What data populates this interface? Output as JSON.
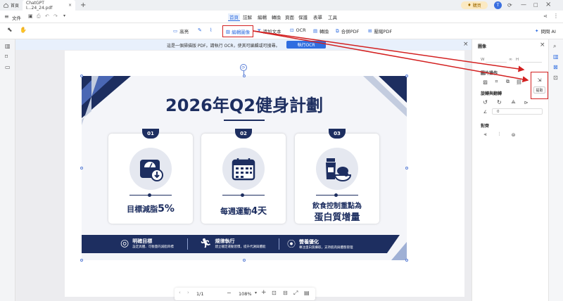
{
  "tabs": [
    {
      "label": "首頁"
    },
    {
      "label": "ChatGPT I...24_24.pdf"
    }
  ],
  "upgrade_label": "購買",
  "avatar_letter": "T",
  "file_menu": "文件",
  "menu_tabs": [
    "首頁",
    "註解",
    "編輯",
    "轉換",
    "頁面",
    "保護",
    "表單",
    "工具"
  ],
  "toolbar": {
    "highlight": "高亮",
    "edit_image": "編輯圖像",
    "add_text": "添加文本",
    "ocr": "OCR",
    "convert": "轉換",
    "merge": "合併PDF",
    "compress": "壓縮PDF",
    "ask_ai": "問問 AI"
  },
  "notice": {
    "text": "這是一個掃描版 PDF。請執行 OCR，使其可編輯或可搜尋。",
    "button": "執行OCR"
  },
  "slide": {
    "title": "2026年Q2健身計劃",
    "cards": [
      {
        "num": "01",
        "text": "目標減脂",
        "highlight": "5%"
      },
      {
        "num": "02",
        "text": "每週運動",
        "highlight": "4天"
      },
      {
        "num": "03",
        "text": "飲食控制重點為",
        "line2": "蛋白質增量"
      }
    ],
    "footer": [
      {
        "title": "明確目標",
        "desc": "設定具體、可衡量的減脂目標"
      },
      {
        "title": "規律執行",
        "desc": "建立穩定運動習慣，提升代謝與體能"
      },
      {
        "title": "營養優化",
        "desc": "專注蛋白質攝取，支持肌肉與體態管理"
      }
    ]
  },
  "right_panel": {
    "title": "圖像",
    "w_label": "W",
    "h_label": "H",
    "image_ops_title": "圖片操作",
    "rotate_title": "旋轉與翻轉",
    "rotate_angle": "0",
    "align_title": "對齊",
    "tooltip": "提取"
  },
  "zoom": {
    "page": "1/1",
    "level": "108%"
  }
}
